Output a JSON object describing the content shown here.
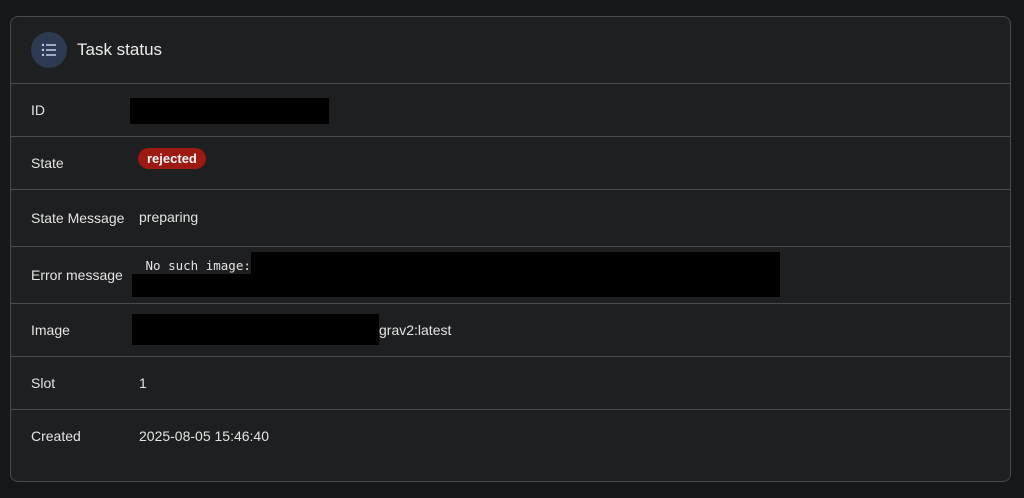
{
  "header": {
    "title": "Task status",
    "icon": "list-icon"
  },
  "rows": [
    {
      "label": "ID",
      "value": ""
    },
    {
      "label": "State",
      "value": "rejected",
      "badge_color": "#9d1a13"
    },
    {
      "label": "State Message",
      "value": "preparing"
    },
    {
      "label": "Error message",
      "value": " No such image:"
    },
    {
      "label": "Image",
      "value": "grav2:latest"
    },
    {
      "label": "Slot",
      "value": "1"
    },
    {
      "label": "Created",
      "value": "2025-08-05 15:46:40"
    }
  ]
}
